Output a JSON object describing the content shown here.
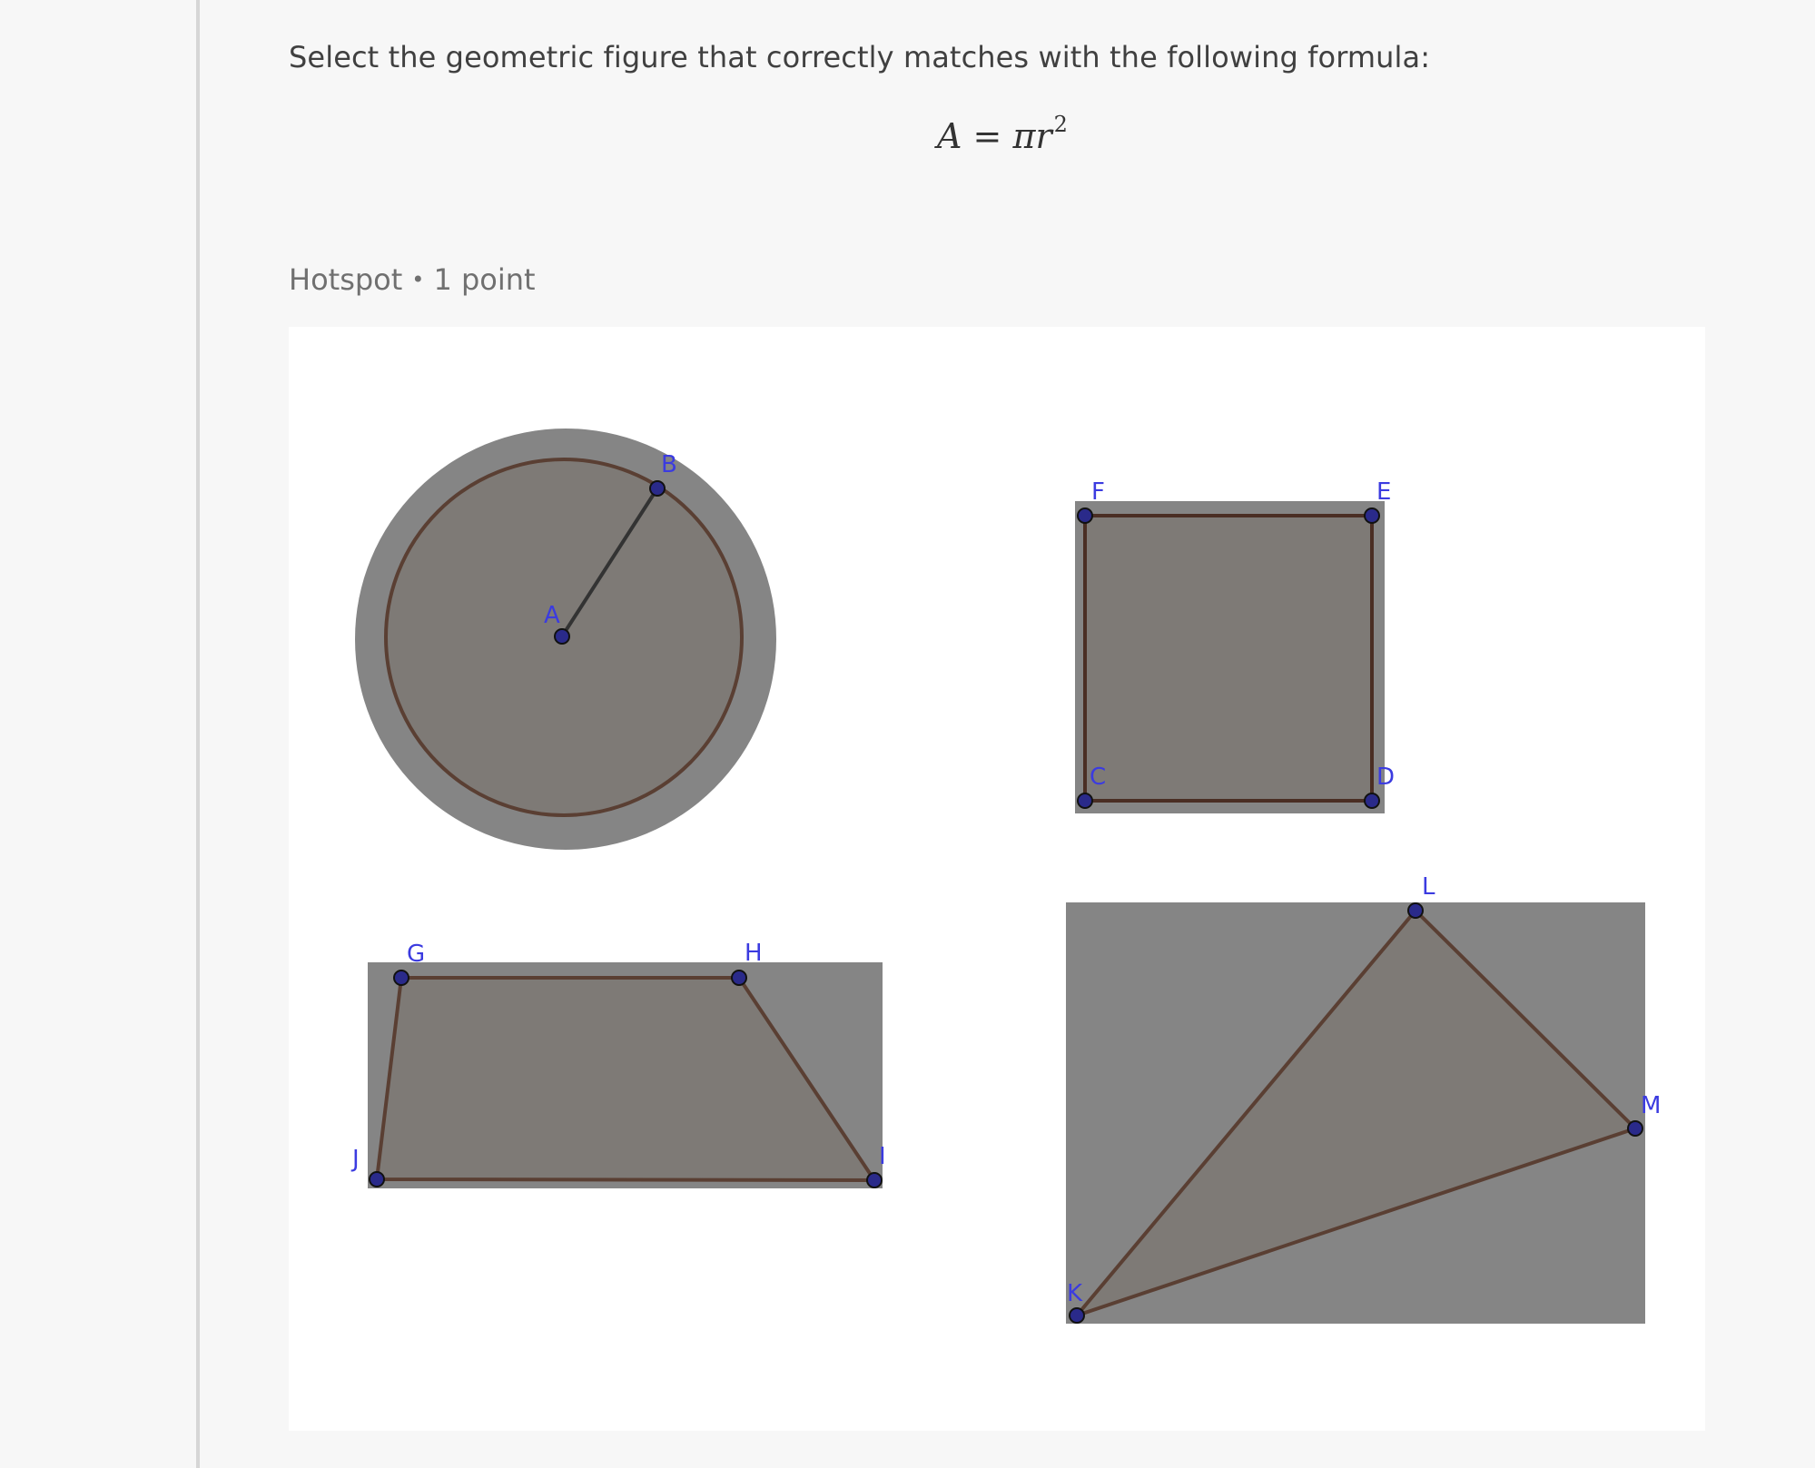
{
  "question": {
    "prompt": "Select the geometric figure that correctly matches with the following formula:",
    "formula": {
      "lhs": "A",
      "equals": "=",
      "pi": "π",
      "var": "r",
      "exponent": "2"
    }
  },
  "meta": {
    "type": "Hotspot",
    "separator": "•",
    "points": "1 point"
  },
  "figures": {
    "circle": {
      "name": "circle",
      "points": [
        "A",
        "B"
      ]
    },
    "square": {
      "name": "square",
      "points": [
        "F",
        "E",
        "C",
        "D"
      ]
    },
    "trapezoid": {
      "name": "trapezoid",
      "points": [
        "G",
        "H",
        "J",
        "I"
      ]
    },
    "triangle": {
      "name": "triangle",
      "points": [
        "L",
        "M",
        "K"
      ]
    }
  },
  "colors": {
    "hotspot_fill": "#858585",
    "shape_fill": "#7e7a76",
    "shape_stroke": "#5a3f33",
    "point_fill": "#2a2a8a",
    "label": "#3b3be0"
  }
}
